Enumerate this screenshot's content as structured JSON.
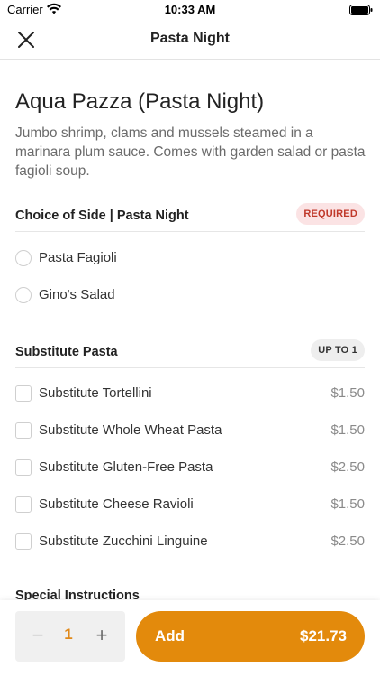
{
  "status_bar": {
    "carrier": "Carrier",
    "time": "10:33 AM"
  },
  "nav": {
    "title": "Pasta Night",
    "close_icon": "close-icon"
  },
  "item": {
    "title": "Aqua Pazza (Pasta Night)",
    "description": "Jumbo shrimp, clams and mussels steamed in a marinara plum sauce. Comes with garden salad or pasta fagioli soup."
  },
  "groups": [
    {
      "title": "Choice of Side | Pasta Night",
      "badge": "REQUIRED",
      "input_type": "radio",
      "options": [
        {
          "label": "Pasta Fagioli",
          "price": ""
        },
        {
          "label": "Gino's Salad",
          "price": ""
        }
      ]
    },
    {
      "title": "Substitute Pasta",
      "badge": "UP TO 1",
      "input_type": "checkbox",
      "options": [
        {
          "label": "Substitute Tortellini",
          "price": "$1.50"
        },
        {
          "label": "Substitute Whole Wheat Pasta",
          "price": "$1.50"
        },
        {
          "label": "Substitute Gluten-Free Pasta",
          "price": "$2.50"
        },
        {
          "label": "Substitute Cheese Ravioli",
          "price": "$1.50"
        },
        {
          "label": "Substitute Zucchini Linguine",
          "price": "$2.50"
        }
      ]
    }
  ],
  "next_section_partial": "Special Instructions",
  "cart": {
    "quantity": "1",
    "minus_symbol": "−",
    "plus_symbol": "+",
    "add_label": "Add",
    "total": "$21.73"
  },
  "colors": {
    "accent": "#e38a0c",
    "required_badge_bg": "#fbe3e4",
    "required_badge_text": "#c0392b"
  }
}
